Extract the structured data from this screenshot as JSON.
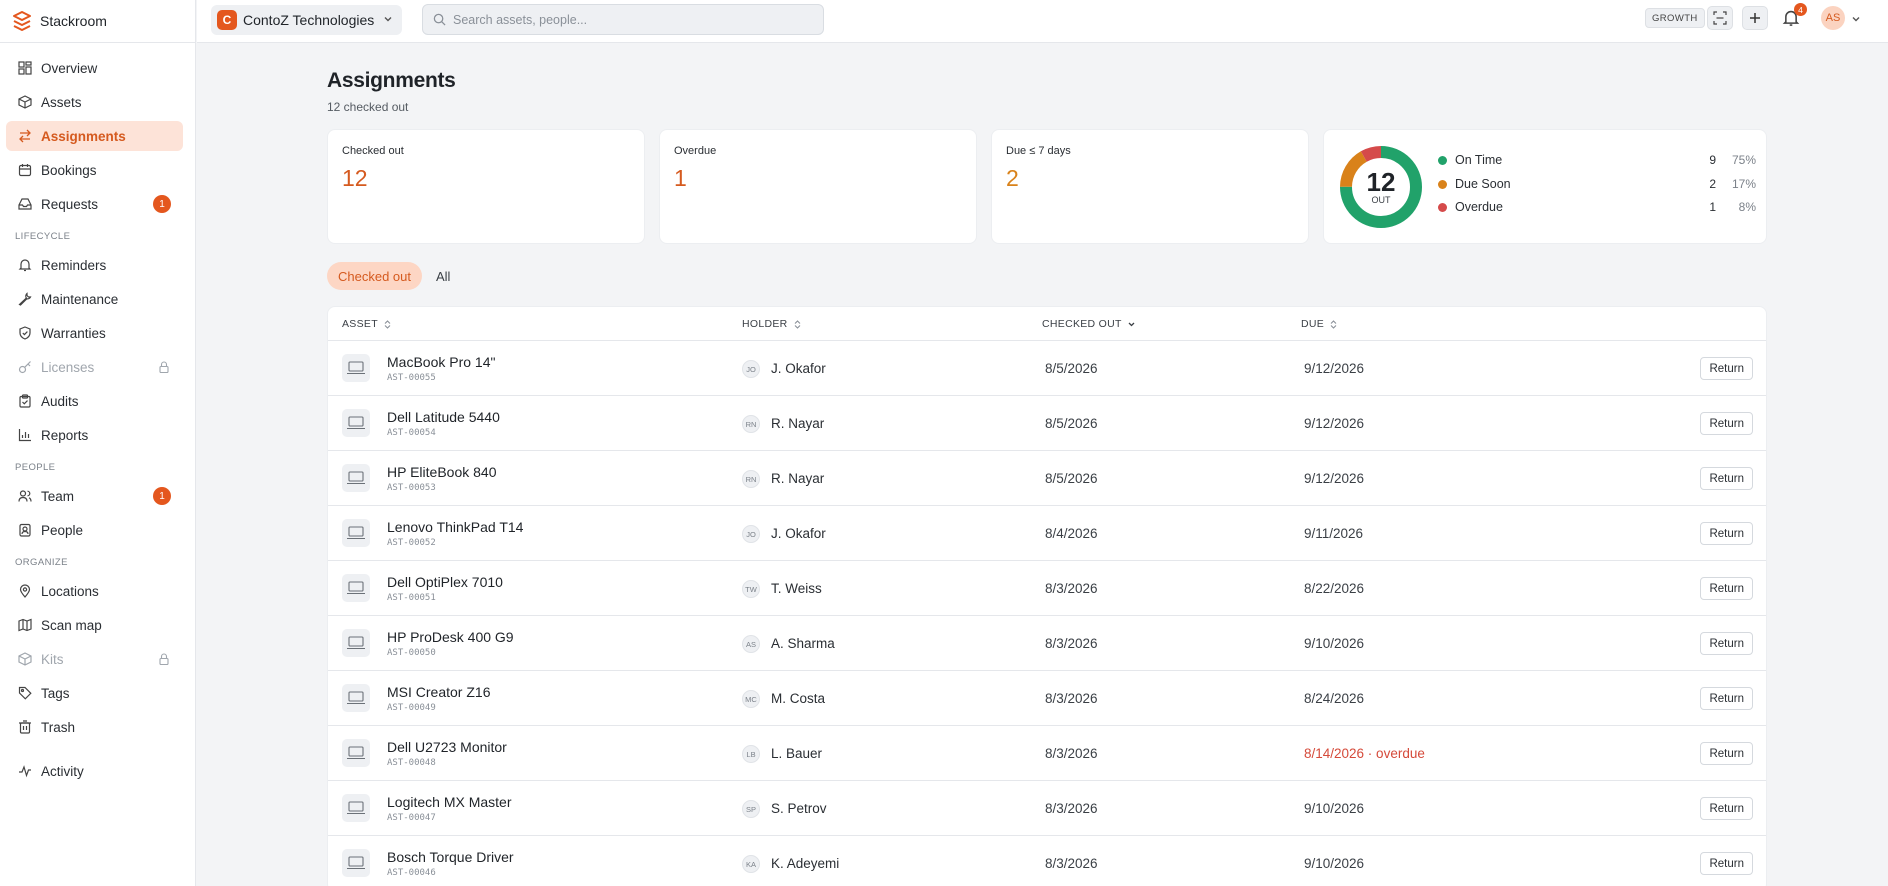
{
  "brand": {
    "name": "Stackroom"
  },
  "org": {
    "initial": "C",
    "name": "ContoZ Technologies"
  },
  "search": {
    "placeholder": "Search assets, people..."
  },
  "topbar": {
    "plan_badge": "GROWTH",
    "notifications_count": "4",
    "user_initials": "AS"
  },
  "sidebar": {
    "items_main": [
      {
        "label": "Overview",
        "icon": "overview-icon"
      },
      {
        "label": "Assets",
        "icon": "box-icon"
      },
      {
        "label": "Assignments",
        "icon": "swap-icon",
        "active": true
      },
      {
        "label": "Bookings",
        "icon": "calendar-icon"
      },
      {
        "label": "Requests",
        "icon": "inbox-icon",
        "badge": "1"
      }
    ],
    "section_lifecycle": "LIFECYCLE",
    "items_lifecycle": [
      {
        "label": "Reminders",
        "icon": "bell-icon"
      },
      {
        "label": "Maintenance",
        "icon": "wrench-icon"
      },
      {
        "label": "Warranties",
        "icon": "shield-icon"
      },
      {
        "label": "Licenses",
        "icon": "key-icon",
        "locked": true
      },
      {
        "label": "Audits",
        "icon": "clipboard-icon"
      },
      {
        "label": "Reports",
        "icon": "bar-chart-icon"
      }
    ],
    "section_people": "PEOPLE",
    "items_people": [
      {
        "label": "Team",
        "icon": "users-icon",
        "badge": "1"
      },
      {
        "label": "People",
        "icon": "contact-icon"
      }
    ],
    "section_organize": "ORGANIZE",
    "items_organize": [
      {
        "label": "Locations",
        "icon": "pin-icon"
      },
      {
        "label": "Scan map",
        "icon": "map-icon"
      },
      {
        "label": "Kits",
        "icon": "kit-icon",
        "locked": true
      },
      {
        "label": "Tags",
        "icon": "tag-icon"
      },
      {
        "label": "Trash",
        "icon": "trash-icon"
      }
    ],
    "activity": {
      "label": "Activity",
      "icon": "activity-icon"
    }
  },
  "page": {
    "title": "Assignments",
    "subtitle": "12 checked out"
  },
  "stats": {
    "checked_out": {
      "label": "Checked out",
      "value": "12"
    },
    "overdue": {
      "label": "Overdue",
      "value": "1"
    },
    "due_soon": {
      "label": "Due ≤ 7 days",
      "value": "2"
    }
  },
  "donut": {
    "total": "12",
    "caption": "OUT",
    "segments": [
      {
        "label": "On Time",
        "count": "9",
        "pct": "75%",
        "value": 9,
        "color": "#21a26a"
      },
      {
        "label": "Due Soon",
        "count": "2",
        "pct": "17%",
        "value": 2,
        "color": "#d9821a"
      },
      {
        "label": "Overdue",
        "count": "1",
        "pct": "8%",
        "value": 1,
        "color": "#d54a4a"
      }
    ]
  },
  "tabs": {
    "checked_out": "Checked out",
    "all": "All"
  },
  "table": {
    "headers": {
      "asset": "ASSET",
      "holder": "HOLDER",
      "checked_out": "CHECKED OUT",
      "due": "DUE"
    },
    "return_label": "Return",
    "rows": [
      {
        "name": "MacBook Pro 14\"",
        "tag": "AST-00055",
        "holder_initials": "JO",
        "holder": "J. Okafor",
        "checked_out": "8/5/2026",
        "due": "9/12/2026",
        "overdue": false
      },
      {
        "name": "Dell Latitude 5440",
        "tag": "AST-00054",
        "holder_initials": "RN",
        "holder": "R. Nayar",
        "checked_out": "8/5/2026",
        "due": "9/12/2026",
        "overdue": false
      },
      {
        "name": "HP EliteBook 840",
        "tag": "AST-00053",
        "holder_initials": "RN",
        "holder": "R. Nayar",
        "checked_out": "8/5/2026",
        "due": "9/12/2026",
        "overdue": false
      },
      {
        "name": "Lenovo ThinkPad T14",
        "tag": "AST-00052",
        "holder_initials": "JO",
        "holder": "J. Okafor",
        "checked_out": "8/4/2026",
        "due": "9/11/2026",
        "overdue": false
      },
      {
        "name": "Dell OptiPlex 7010",
        "tag": "AST-00051",
        "holder_initials": "TW",
        "holder": "T. Weiss",
        "checked_out": "8/3/2026",
        "due": "8/22/2026",
        "overdue": false
      },
      {
        "name": "HP ProDesk 400 G9",
        "tag": "AST-00050",
        "holder_initials": "AS",
        "holder": "A. Sharma",
        "checked_out": "8/3/2026",
        "due": "9/10/2026",
        "overdue": false
      },
      {
        "name": "MSI Creator Z16",
        "tag": "AST-00049",
        "holder_initials": "MC",
        "holder": "M. Costa",
        "checked_out": "8/3/2026",
        "due": "8/24/2026",
        "overdue": false
      },
      {
        "name": "Dell U2723 Monitor",
        "tag": "AST-00048",
        "holder_initials": "LB",
        "holder": "L. Bauer",
        "checked_out": "8/3/2026",
        "due": "8/14/2026 · overdue",
        "overdue": true
      },
      {
        "name": "Logitech MX Master",
        "tag": "AST-00047",
        "holder_initials": "SP",
        "holder": "S. Petrov",
        "checked_out": "8/3/2026",
        "due": "9/10/2026",
        "overdue": false
      },
      {
        "name": "Bosch Torque Driver",
        "tag": "AST-00046",
        "holder_initials": "KA",
        "holder": "K. Adeyemi",
        "checked_out": "8/3/2026",
        "due": "9/10/2026",
        "overdue": false
      }
    ]
  },
  "colors": {
    "accent": "#e4571e",
    "accent_text": "#d55a1f",
    "overdue_text": "#d54a3a"
  }
}
